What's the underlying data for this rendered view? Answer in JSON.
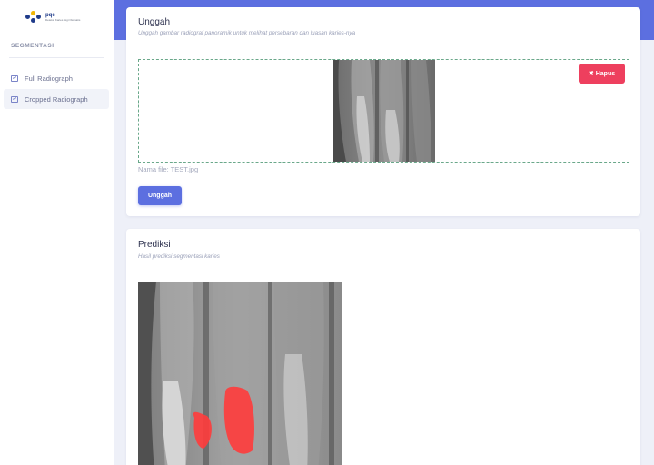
{
  "sidebar": {
    "logo_title": "pqc",
    "logo_subtitle": "Deteksi Karies Gigi Otomatis",
    "section_heading": "SEGMENTASI",
    "items": [
      {
        "label": "Full Radiograph",
        "icon": "image-icon"
      },
      {
        "label": "Cropped Radiograph",
        "icon": "image-icon"
      }
    ]
  },
  "upload": {
    "title": "Unggah",
    "subtitle": "Unggah gambar radiograf panoramik untuk melihat persebaran dan luasan karies-nya",
    "delete_label": "Hapus",
    "filename": "Nama file: TEST.jpg",
    "submit_label": "Unggah"
  },
  "prediction": {
    "title": "Prediksi",
    "subtitle": "Hasil prediksi segmentasi karies"
  },
  "colors": {
    "accent": "#5c6fe0",
    "danger": "#ee3f5e",
    "overlay": "#ff3b3b"
  }
}
